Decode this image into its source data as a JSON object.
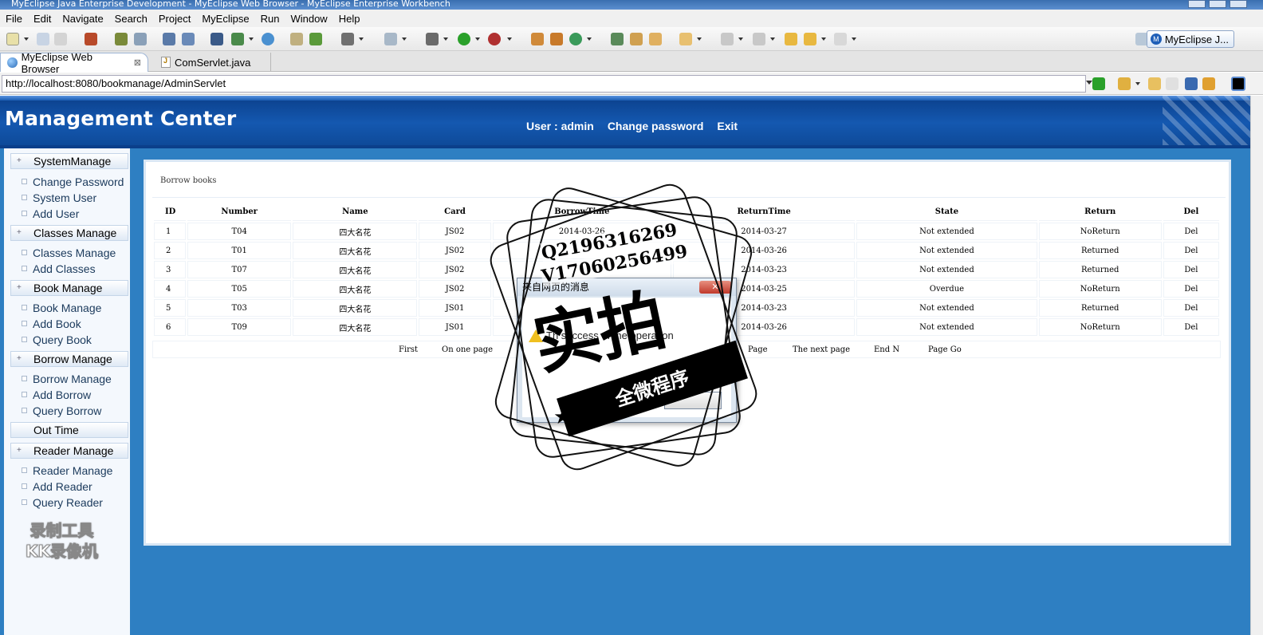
{
  "window": {
    "title": "MyEclipse Java Enterprise Development - MyEclipse Web Browser - MyEclipse Enterprise Workbench"
  },
  "menu": [
    "File",
    "Edit",
    "Navigate",
    "Search",
    "Project",
    "MyEclipse",
    "Run",
    "Window",
    "Help"
  ],
  "perspective": {
    "label": "MyEclipse J..."
  },
  "tabs": [
    {
      "label": "MyEclipse Web Browser",
      "close": "⊠"
    },
    {
      "label": "ComServlet.java"
    }
  ],
  "address": {
    "url": "http://localhost:8080/bookmanage/AdminServlet"
  },
  "header": {
    "title": "Management Center",
    "user": "User : admin",
    "change_password": "Change password",
    "exit": "Exit"
  },
  "sidebar": {
    "groups": [
      {
        "label": "SystemManage",
        "items": [
          "Change Password",
          "System User",
          "Add User"
        ]
      },
      {
        "label": "Classes Manage",
        "items": [
          "Classes Manage",
          "Add Classes"
        ]
      },
      {
        "label": "Book Manage",
        "items": [
          "Book Manage",
          "Add Book",
          "Query Book"
        ]
      },
      {
        "label": "Borrow Manage",
        "items": [
          "Borrow Manage",
          "Add Borrow",
          "Query Borrow"
        ]
      },
      {
        "label": "Out Time",
        "items": []
      },
      {
        "label": "Reader Manage",
        "items": [
          "Reader Manage",
          "Add Reader",
          "Query Reader"
        ]
      }
    ],
    "watermark": [
      "录制工具",
      "KK录像机"
    ]
  },
  "content": {
    "title": "Borrow books",
    "columns": [
      "ID",
      "Number",
      "Name",
      "Card",
      "BorrowTime",
      "ReturnTime",
      "State",
      "Return",
      "Del"
    ],
    "rows": [
      [
        "1",
        "T04",
        "四大名花",
        "JS02",
        "2014-03-26",
        "2014-03-27",
        "Not extended",
        "NoReturn",
        "Del"
      ],
      [
        "2",
        "T01",
        "四大名花",
        "JS02",
        "",
        "2014-03-26",
        "Not extended",
        "Returned",
        "Del"
      ],
      [
        "3",
        "T07",
        "四大名花",
        "JS02",
        "",
        "2014-03-23",
        "Not extended",
        "Returned",
        "Del"
      ],
      [
        "4",
        "T05",
        "四大名花",
        "JS02",
        "",
        "2014-03-25",
        "Overdue",
        "NoReturn",
        "Del"
      ],
      [
        "5",
        "T03",
        "四大名花",
        "JS01",
        "",
        "2014-03-23",
        "Not extended",
        "Returned",
        "Del"
      ],
      [
        "6",
        "T09",
        "四大名花",
        "JS01",
        "",
        "2014-03-26",
        "Not extended",
        "NoReturn",
        "Del"
      ]
    ],
    "pager": {
      "first": "First",
      "prev": "On one page",
      "page": "Page",
      "next": "The next page",
      "end": "End N",
      "go": "Page Go"
    }
  },
  "dialog": {
    "title": "来自网页的消息",
    "message": "Th success of the operation",
    "close": "✕"
  },
  "stamp": {
    "phone1": "Q2196316269",
    "phone2": "V17060256499",
    "big": "实拍",
    "ribbon": "全微程序"
  }
}
